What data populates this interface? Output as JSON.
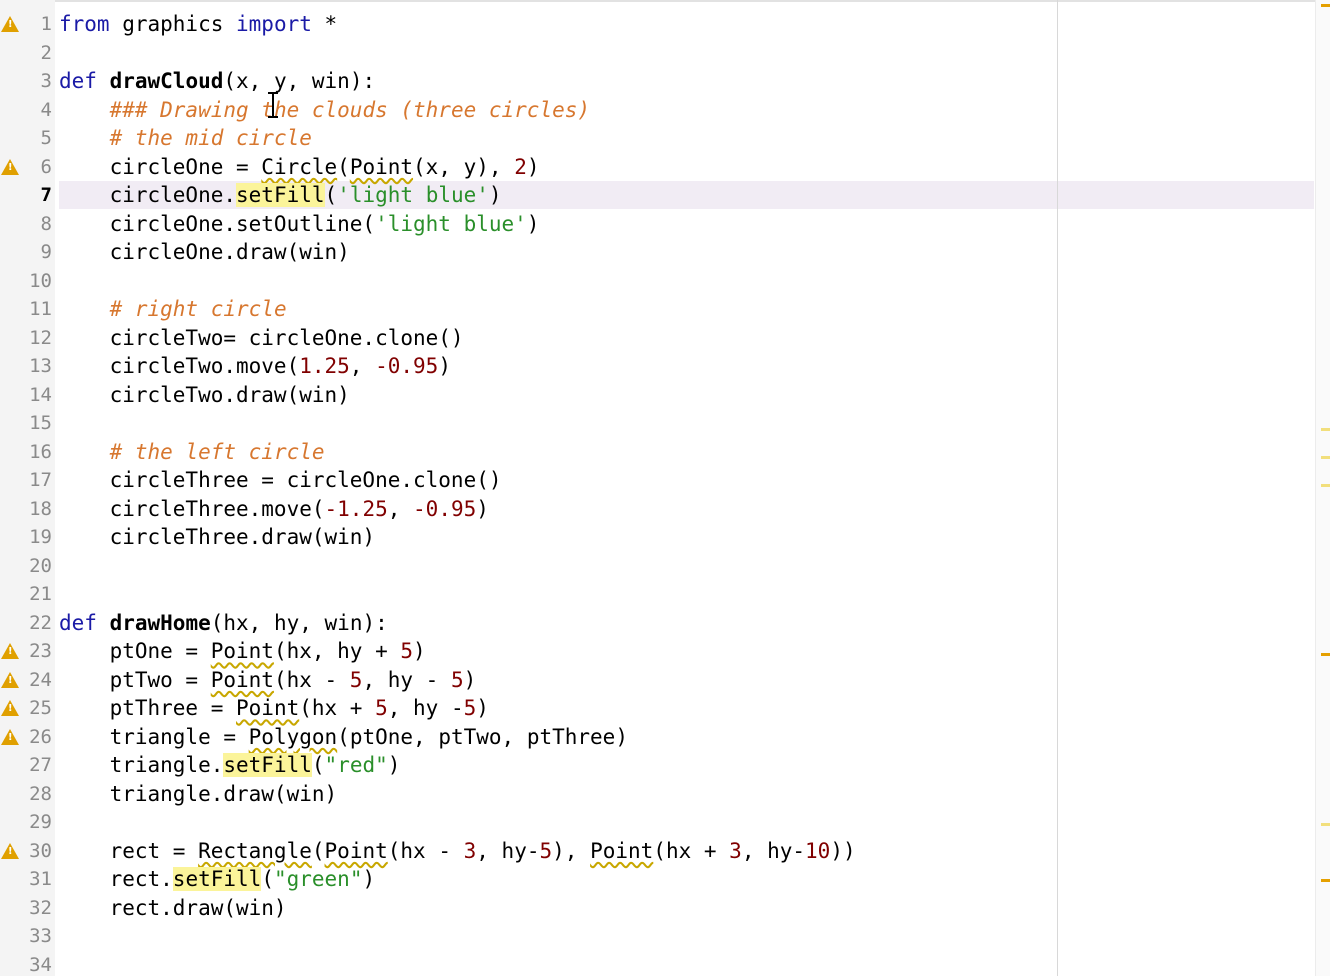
{
  "editor": {
    "current_line": 7,
    "warning_lines": [
      1,
      6,
      23,
      24,
      25,
      26,
      30
    ],
    "lines": [
      [
        {
          "t": "from",
          "c": "kw"
        },
        {
          "t": " graphics "
        },
        {
          "t": "import",
          "c": "kw"
        },
        {
          "t": " *"
        }
      ],
      [],
      [
        {
          "t": "def",
          "c": "kw"
        },
        {
          "t": " "
        },
        {
          "t": "drawCloud",
          "c": "fn"
        },
        {
          "t": "(x, y, win):"
        }
      ],
      [
        {
          "t": "    "
        },
        {
          "t": "### Drawing the clouds (three circles)",
          "c": "cm"
        }
      ],
      [
        {
          "t": "    "
        },
        {
          "t": "# the mid circle",
          "c": "cm"
        }
      ],
      [
        {
          "t": "    circleOne = "
        },
        {
          "t": "Circle",
          "c": "sq"
        },
        {
          "t": "("
        },
        {
          "t": "Point",
          "c": "sq"
        },
        {
          "t": "(x, y), "
        },
        {
          "t": "2",
          "c": "num"
        },
        {
          "t": ")"
        }
      ],
      [
        {
          "t": "    circleOne."
        },
        {
          "t": "setFill",
          "c": "occ"
        },
        {
          "t": "("
        },
        {
          "t": "'light blue'",
          "c": "str"
        },
        {
          "t": ")"
        }
      ],
      [
        {
          "t": "    circleOne.setOutline("
        },
        {
          "t": "'light blue'",
          "c": "str"
        },
        {
          "t": ")"
        }
      ],
      [
        {
          "t": "    circleOne.draw(win)"
        }
      ],
      [],
      [
        {
          "t": "    "
        },
        {
          "t": "# right circle",
          "c": "cm"
        }
      ],
      [
        {
          "t": "    circleTwo= circleOne.clone()"
        }
      ],
      [
        {
          "t": "    circleTwo.move("
        },
        {
          "t": "1.25",
          "c": "num"
        },
        {
          "t": ", "
        },
        {
          "t": "-0.95",
          "c": "num"
        },
        {
          "t": ")"
        }
      ],
      [
        {
          "t": "    circleTwo.draw(win)"
        }
      ],
      [],
      [
        {
          "t": "    "
        },
        {
          "t": "# the left circle",
          "c": "cm"
        }
      ],
      [
        {
          "t": "    circleThree = circleOne.clone()"
        }
      ],
      [
        {
          "t": "    circleThree.move("
        },
        {
          "t": "-1.25",
          "c": "num"
        },
        {
          "t": ", "
        },
        {
          "t": "-0.95",
          "c": "num"
        },
        {
          "t": ")"
        }
      ],
      [
        {
          "t": "    circleThree.draw(win)"
        }
      ],
      [],
      [],
      [
        {
          "t": "def",
          "c": "kw"
        },
        {
          "t": " "
        },
        {
          "t": "drawHome",
          "c": "fn"
        },
        {
          "t": "(hx, hy, win):"
        }
      ],
      [
        {
          "t": "    ptOne = "
        },
        {
          "t": "Point",
          "c": "sq"
        },
        {
          "t": "(hx, hy + "
        },
        {
          "t": "5",
          "c": "num"
        },
        {
          "t": ")"
        }
      ],
      [
        {
          "t": "    ptTwo = "
        },
        {
          "t": "Point",
          "c": "sq"
        },
        {
          "t": "(hx - "
        },
        {
          "t": "5",
          "c": "num"
        },
        {
          "t": ", hy - "
        },
        {
          "t": "5",
          "c": "num"
        },
        {
          "t": ")"
        }
      ],
      [
        {
          "t": "    ptThree = "
        },
        {
          "t": "Point",
          "c": "sq"
        },
        {
          "t": "(hx + "
        },
        {
          "t": "5",
          "c": "num"
        },
        {
          "t": ", hy -"
        },
        {
          "t": "5",
          "c": "num"
        },
        {
          "t": ")"
        }
      ],
      [
        {
          "t": "    triangle = "
        },
        {
          "t": "Polygon",
          "c": "sq"
        },
        {
          "t": "(ptOne, ptTwo, ptThree)"
        }
      ],
      [
        {
          "t": "    triangle."
        },
        {
          "t": "setFill",
          "c": "occ"
        },
        {
          "t": "("
        },
        {
          "t": "\"red\"",
          "c": "str"
        },
        {
          "t": ")"
        }
      ],
      [
        {
          "t": "    triangle.draw(win)"
        }
      ],
      [],
      [
        {
          "t": "    rect = "
        },
        {
          "t": "Rectangle",
          "c": "sq"
        },
        {
          "t": "("
        },
        {
          "t": "Point",
          "c": "sq"
        },
        {
          "t": "(hx - "
        },
        {
          "t": "3",
          "c": "num"
        },
        {
          "t": ", hy-"
        },
        {
          "t": "5",
          "c": "num"
        },
        {
          "t": "), "
        },
        {
          "t": "Point",
          "c": "sq"
        },
        {
          "t": "(hx + "
        },
        {
          "t": "3",
          "c": "num"
        },
        {
          "t": ", hy-"
        },
        {
          "t": "10",
          "c": "num"
        },
        {
          "t": "))"
        }
      ],
      [
        {
          "t": "    rect."
        },
        {
          "t": "setFill",
          "c": "occ"
        },
        {
          "t": "("
        },
        {
          "t": "\"green\"",
          "c": "str"
        },
        {
          "t": ")"
        }
      ],
      [
        {
          "t": "    rect.draw(win)"
        }
      ],
      [],
      []
    ]
  },
  "overview_ruler": {
    "markers": [
      {
        "line": 1,
        "kind": "warning"
      },
      {
        "line": 16,
        "kind": "occurrence"
      },
      {
        "line": 17,
        "kind": "occurrence"
      },
      {
        "line": 18,
        "kind": "occurrence"
      },
      {
        "line": 24,
        "kind": "warning"
      },
      {
        "line": 30,
        "kind": "occurrence"
      },
      {
        "line": 32,
        "kind": "warning"
      }
    ]
  },
  "colors": {
    "keyword": "#1a1aa6",
    "comment": "#d7772f",
    "string": "#2a8f2a",
    "number": "#800000",
    "current_line_bg": "#f1ecf4",
    "occurrence_bg": "#fbf49a",
    "warning": "#e0a000"
  }
}
